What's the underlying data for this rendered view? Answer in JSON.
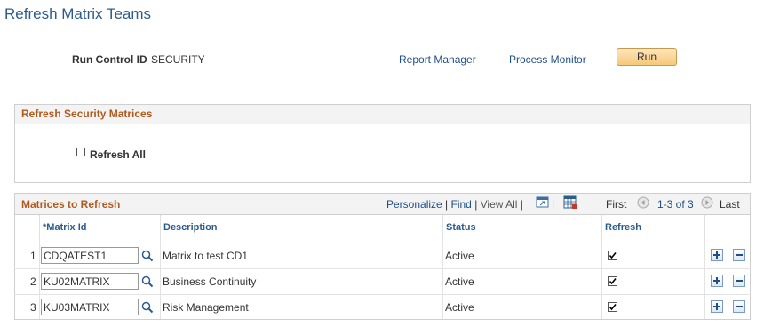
{
  "page": {
    "title": "Refresh Matrix Teams"
  },
  "header": {
    "run_control_label": "Run Control ID",
    "run_control_value": "SECURITY",
    "report_manager": "Report Manager",
    "process_monitor": "Process Monitor",
    "run": "Run"
  },
  "refresh_section": {
    "title": "Refresh Security Matrices",
    "refresh_all_label": "Refresh All",
    "refresh_all_checked": false
  },
  "grid": {
    "title": "Matrices to Refresh",
    "personalize": "Personalize",
    "find": "Find",
    "view_all": "View All",
    "first": "First",
    "range": "1-3 of 3",
    "last": "Last",
    "columns": {
      "matrix_id": "*Matrix Id",
      "description": "Description",
      "status": "Status",
      "refresh": "Refresh"
    },
    "rows": [
      {
        "num": "1",
        "matrix_id": "CDQATEST1",
        "description": "Matrix to test CD1",
        "status": "Active",
        "refresh": true
      },
      {
        "num": "2",
        "matrix_id": "KU02MATRIX",
        "description": "Business Continuity",
        "status": "Active",
        "refresh": true
      },
      {
        "num": "3",
        "matrix_id": "KU03MATRIX",
        "description": "Risk Management",
        "status": "Active",
        "refresh": true
      }
    ]
  },
  "colors": {
    "title_blue": "#2c5c8e",
    "section_orange": "#b15a1e",
    "link_blue": "#1f4f8a",
    "run_button": "#f6c879"
  }
}
